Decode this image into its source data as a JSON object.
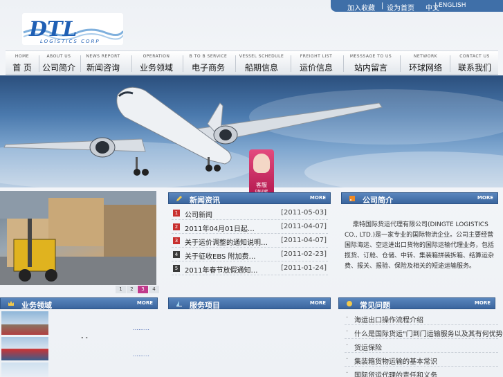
{
  "top_links": {
    "favorite": "加入收藏",
    "homepage": "设为首页",
    "lang_cn": "中文",
    "lang_en": "ENGLISH",
    "sep": "|"
  },
  "logo": {
    "main": "DTL",
    "sub": "LOGISTICS CORP"
  },
  "nav": [
    {
      "en": "HOME",
      "zh": "首  页"
    },
    {
      "en": "ABOUT US",
      "zh": "公司简介"
    },
    {
      "en": "NEWS REPORT",
      "zh": "新闻咨询"
    },
    {
      "en": "OPERATION",
      "zh": "业务领域"
    },
    {
      "en": "B TO B SERVICE",
      "zh": "电子商务"
    },
    {
      "en": "VESSEL SCHEDULE",
      "zh": "船期信息"
    },
    {
      "en": "FREIGHT LIST",
      "zh": "运价信息"
    },
    {
      "en": "MESSSAGE TO US",
      "zh": "站内留言"
    },
    {
      "en": "NETWORK",
      "zh": "环球网络"
    },
    {
      "en": "CONTACT US",
      "zh": "联系我们"
    }
  ],
  "kefu": {
    "label": "客服",
    "online": "ONLINE"
  },
  "pager": [
    "1",
    "2",
    "3",
    "4"
  ],
  "news": {
    "title": "新闻资讯",
    "more": "MORE",
    "items": [
      {
        "num": "1",
        "title": "公司新闻",
        "date": "[2011-05-03]"
      },
      {
        "num": "2",
        "title": "2011年04月01日起…",
        "date": "[2011-04-07]"
      },
      {
        "num": "3",
        "title": "关于运价调整的通知说明…",
        "date": "[2011-04-07]"
      },
      {
        "num": "4",
        "title": "关于征收EBS 附加费…",
        "date": "[2011-02-23]"
      },
      {
        "num": "5",
        "title": "2011年春节放假通知…",
        "date": "[2011-01-24]"
      }
    ]
  },
  "about": {
    "title": "公司简介",
    "more": "MORE",
    "text": "鼎特国际货运代理有限公司(DINGTE LOGISTICS CO., LTD.)是一家专业的国际物流企业。公司主要经营国际海运、空运进出口货物的国际运输代理业务，包括揽货、订舱、仓储、中转、集装箱拼装拆箱、结算运杂费、报关、报验、保险及相关的短途运输服务。"
  },
  "business": {
    "title": "业务领域",
    "more": "MORE",
    "link1": "………",
    "link2": "………",
    "marker": "\" \""
  },
  "service": {
    "title": "服务项目",
    "more": "MORE"
  },
  "faq": {
    "title": "常见问题",
    "more": "MORE",
    "items": [
      "海运出口操作流程介绍",
      "什么是国际货运\"门到门运输服务以及其有何优势\"介绍…",
      "货运保险",
      "集装箱货物运输的基本常识",
      "国际货运代理的责任和义务"
    ]
  }
}
